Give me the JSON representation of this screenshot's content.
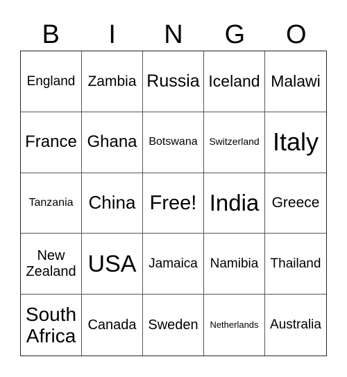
{
  "header": [
    "B",
    "I",
    "N",
    "G",
    "O"
  ],
  "cells": [
    {
      "text": "England",
      "size": 19
    },
    {
      "text": "Zambia",
      "size": 21
    },
    {
      "text": "Russia",
      "size": 25
    },
    {
      "text": "Iceland",
      "size": 23
    },
    {
      "text": "Malawi",
      "size": 23
    },
    {
      "text": "France",
      "size": 24
    },
    {
      "text": "Ghana",
      "size": 24
    },
    {
      "text": "Botswana",
      "size": 16
    },
    {
      "text": "Switzerland",
      "size": 14
    },
    {
      "text": "Italy",
      "size": 36
    },
    {
      "text": "Tanzania",
      "size": 16
    },
    {
      "text": "China",
      "size": 26
    },
    {
      "text": "Free!",
      "size": 29
    },
    {
      "text": "India",
      "size": 33
    },
    {
      "text": "Greece",
      "size": 21
    },
    {
      "text": "New Zealand",
      "size": 20
    },
    {
      "text": "USA",
      "size": 34
    },
    {
      "text": "Jamaica",
      "size": 19
    },
    {
      "text": "Namibia",
      "size": 19
    },
    {
      "text": "Thailand",
      "size": 19
    },
    {
      "text": "South Africa",
      "size": 28
    },
    {
      "text": "Canada",
      "size": 20
    },
    {
      "text": "Sweden",
      "size": 20
    },
    {
      "text": "Netherlands",
      "size": 13
    },
    {
      "text": "Australia",
      "size": 19
    }
  ]
}
